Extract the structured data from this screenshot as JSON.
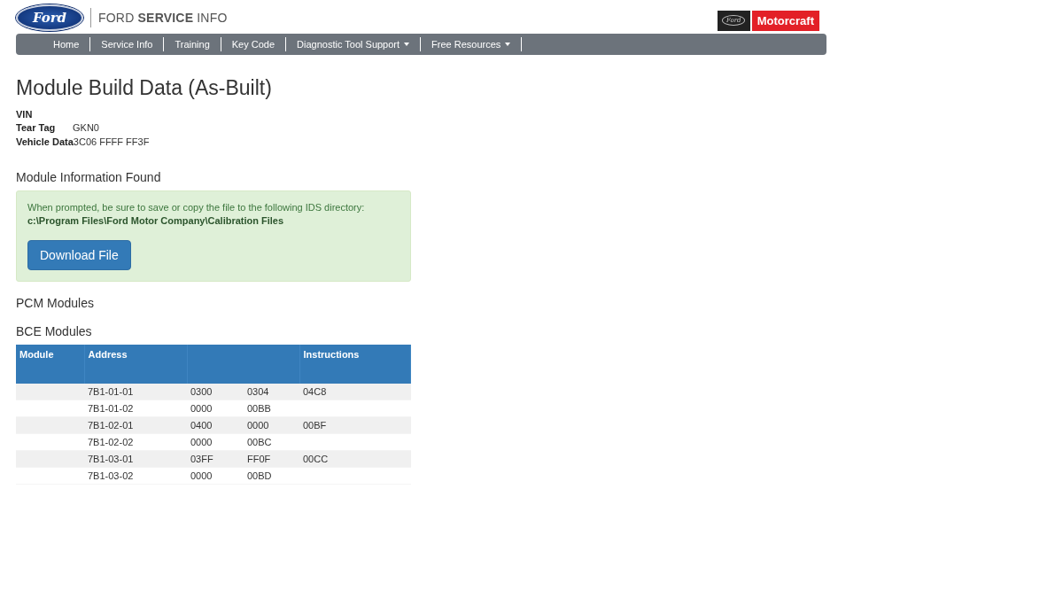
{
  "header": {
    "logo_text": "Ford",
    "site_title": "FORD **SERVICE** INFO",
    "partner_logo_text": "Ford",
    "partner_brand": "Motorcraft"
  },
  "nav": [
    {
      "label": "Home",
      "dropdown": false
    },
    {
      "label": "Service Info",
      "dropdown": false
    },
    {
      "label": "Training",
      "dropdown": false
    },
    {
      "label": "Key Code",
      "dropdown": false
    },
    {
      "label": "Diagnostic Tool Support",
      "dropdown": true
    },
    {
      "label": "Free Resources",
      "dropdown": true
    }
  ],
  "page_title": "Module Build Data (As-Built)",
  "vehicle_fields": [
    {
      "label": "VIN"
    },
    {
      "label": "Tear Tag",
      "value": "GKN0"
    },
    {
      "label": "Vehicle Data",
      "value": "3C06 FFFF FF3F"
    }
  ],
  "found_heading": "Module Information Found",
  "notice": {
    "text": "When prompted, be sure to save or copy the file to the following IDS directory:",
    "path": "c:\\Program Files\\Ford Motor Company\\Calibration Files",
    "button": "Download File"
  },
  "pcm_heading": "PCM Modules",
  "bce_heading": "BCE Modules",
  "table": {
    "columns": [
      "Module",
      "Address",
      "Instructions"
    ],
    "rows": [
      {
        "address": "7B1-01-01",
        "column_3": "0300",
        "column_4": "0304",
        "instructions": "04C8"
      },
      {
        "address": "7B1-01-02",
        "column_3": "0000",
        "column_4": "00BB"
      },
      {
        "address": "7B1-02-01",
        "column_3": "0400",
        "column_4": "0000",
        "instructions": "00BF"
      },
      {
        "address": "7B1-02-02",
        "column_3": "0000",
        "column_4": "00BC"
      },
      {
        "address": "7B1-03-01",
        "column_3": "03FF",
        "column_4": "FF0F",
        "instructions": "00CC"
      },
      {
        "address": "7B1-03-02",
        "column_3": "0000",
        "column_4": "00BD"
      }
    ]
  }
}
